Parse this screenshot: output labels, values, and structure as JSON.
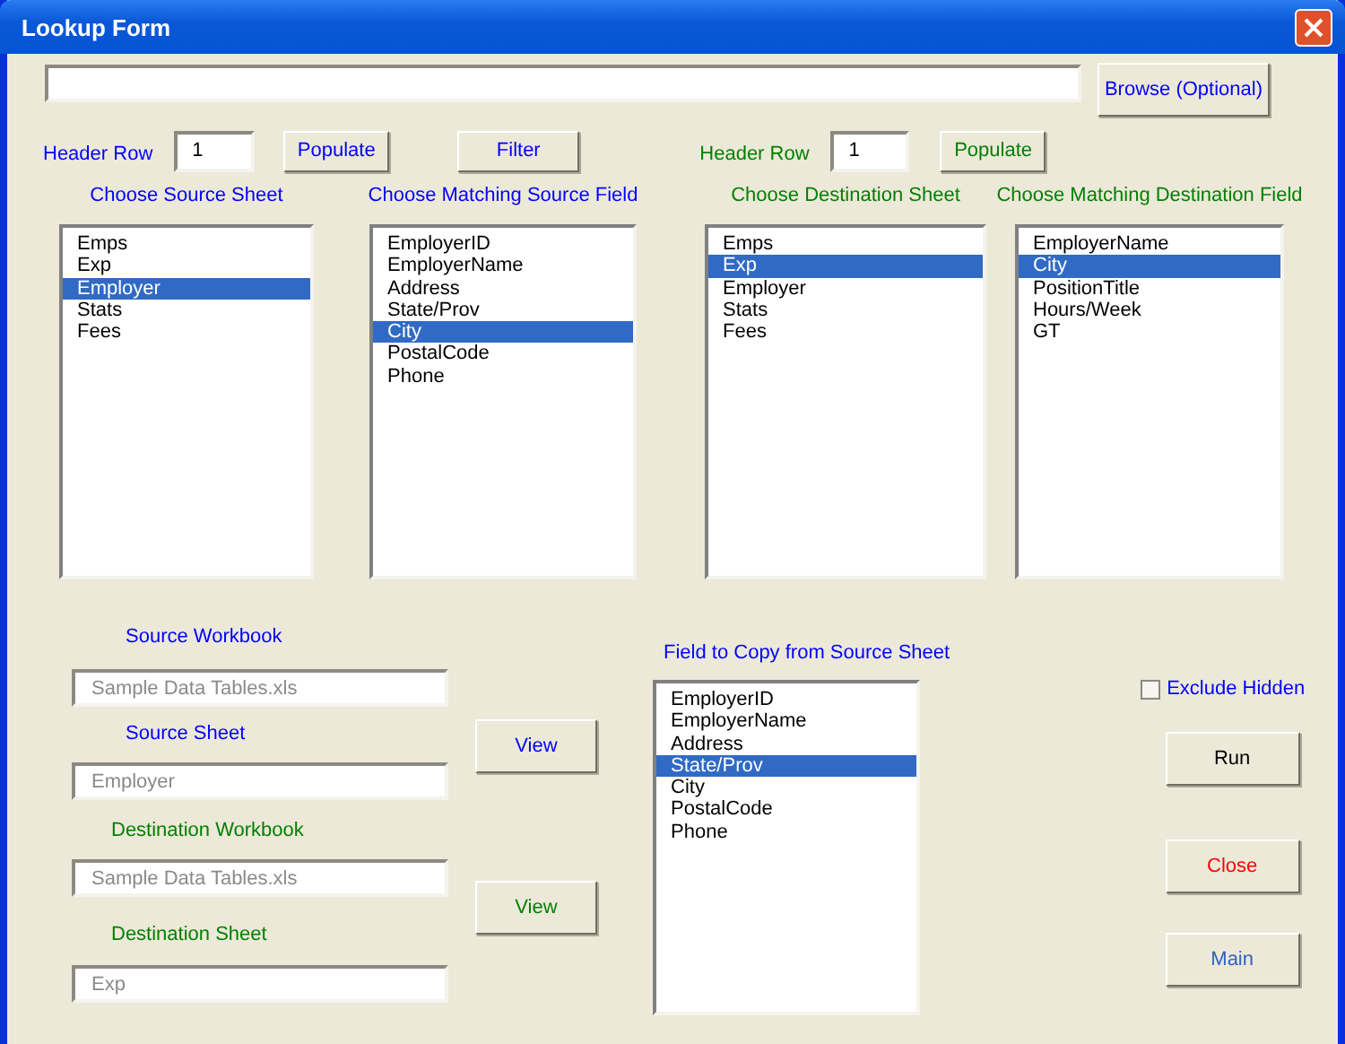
{
  "window": {
    "title": "Lookup Form"
  },
  "browse_button": {
    "label": "Browse (Optional)",
    "color": "#0000ff"
  },
  "source_header": {
    "label": "Header Row",
    "value": "1",
    "button": "Populate",
    "color": "#0000ff"
  },
  "filter_button": {
    "label": "Filter",
    "color": "#0000ff"
  },
  "destination_header": {
    "label": "Header Row",
    "value": "1",
    "button": "Populate",
    "color": "#008000"
  },
  "lists": [
    {
      "title": "Choose Source Sheet",
      "color": "#0000ff",
      "items": [
        {
          "label": "Emps",
          "selected": false
        },
        {
          "label": "Exp",
          "selected": false
        },
        {
          "label": "Employer",
          "selected": true
        },
        {
          "label": "Stats",
          "selected": false
        },
        {
          "label": "Fees",
          "selected": false
        }
      ]
    },
    {
      "title": "Choose Matching Source Field",
      "color": "#0000ff",
      "items": [
        {
          "label": "EmployerID",
          "selected": false
        },
        {
          "label": "EmployerName",
          "selected": false
        },
        {
          "label": "Address",
          "selected": false
        },
        {
          "label": "State/Prov",
          "selected": false
        },
        {
          "label": "City",
          "selected": true
        },
        {
          "label": "PostalCode",
          "selected": false
        },
        {
          "label": "Phone",
          "selected": false
        }
      ]
    },
    {
      "title": "Choose Destination Sheet",
      "color": "#008000",
      "items": [
        {
          "label": "Emps",
          "selected": false
        },
        {
          "label": "Exp",
          "selected": true
        },
        {
          "label": "Employer",
          "selected": false
        },
        {
          "label": "Stats",
          "selected": false
        },
        {
          "label": "Fees",
          "selected": false
        }
      ]
    },
    {
      "title": "Choose Matching Destination Field",
      "color": "#008000",
      "items": [
        {
          "label": "EmployerName",
          "selected": false
        },
        {
          "label": "City",
          "selected": true
        },
        {
          "label": "PositionTitle",
          "selected": false
        },
        {
          "label": "Hours/Week",
          "selected": false
        },
        {
          "label": "GT",
          "selected": false
        }
      ]
    }
  ],
  "fields": [
    {
      "label": "Source Workbook",
      "value": "Sample Data Tables.xls",
      "color": "#0000ff",
      "disabled": true
    },
    {
      "label": "Source Sheet",
      "value": "Employer",
      "color": "#0000ff",
      "disabled": true
    },
    {
      "label": "Destination Workbook",
      "value": "Sample Data Tables.xls",
      "color": "#008000",
      "disabled": true
    },
    {
      "label": "Destination Sheet",
      "value": "Exp",
      "color": "#008000",
      "disabled": true
    }
  ],
  "view_buttons": [
    {
      "label": "View",
      "color": "#0000ff"
    },
    {
      "label": "View",
      "color": "#008000"
    }
  ],
  "copy_list": {
    "title": "Field to Copy from Source Sheet",
    "color": "#0000ff",
    "items": [
      {
        "label": "EmployerID",
        "selected": false
      },
      {
        "label": "EmployerName",
        "selected": false
      },
      {
        "label": "Address",
        "selected": false
      },
      {
        "label": "State/Prov",
        "selected": true
      },
      {
        "label": "City",
        "selected": false
      },
      {
        "label": "PostalCode",
        "selected": false
      },
      {
        "label": "Phone",
        "selected": false
      }
    ]
  },
  "exclude_hidden": {
    "label": "Exclude Hidden",
    "checked": false,
    "color": "#0000ff"
  },
  "actions": [
    {
      "label": "Run",
      "kind": "run"
    },
    {
      "label": "Close",
      "kind": "close"
    },
    {
      "label": "Main",
      "kind": "main"
    }
  ]
}
